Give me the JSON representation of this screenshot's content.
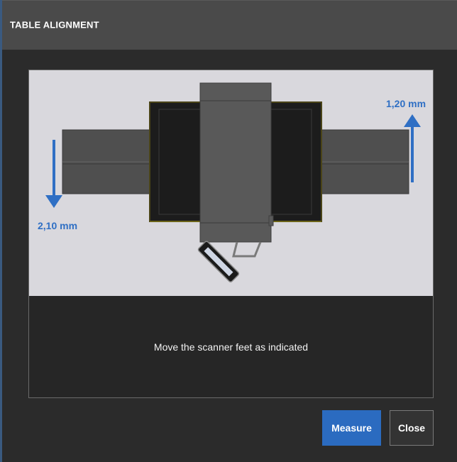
{
  "dialog": {
    "title": "TABLE ALIGNMENT"
  },
  "illustration": {
    "left_adjustment": "2,10 mm",
    "left_direction": "down",
    "right_adjustment": "1,20 mm",
    "right_direction": "up",
    "arrow_color": "#2f6fc4"
  },
  "message": "Move the scanner feet as indicated",
  "buttons": {
    "measure_label": "Measure",
    "close_label": "Close"
  },
  "colors": {
    "accent": "#2b6bc0",
    "titlebar": "#4a4a4a",
    "background": "#2b2b2b"
  }
}
